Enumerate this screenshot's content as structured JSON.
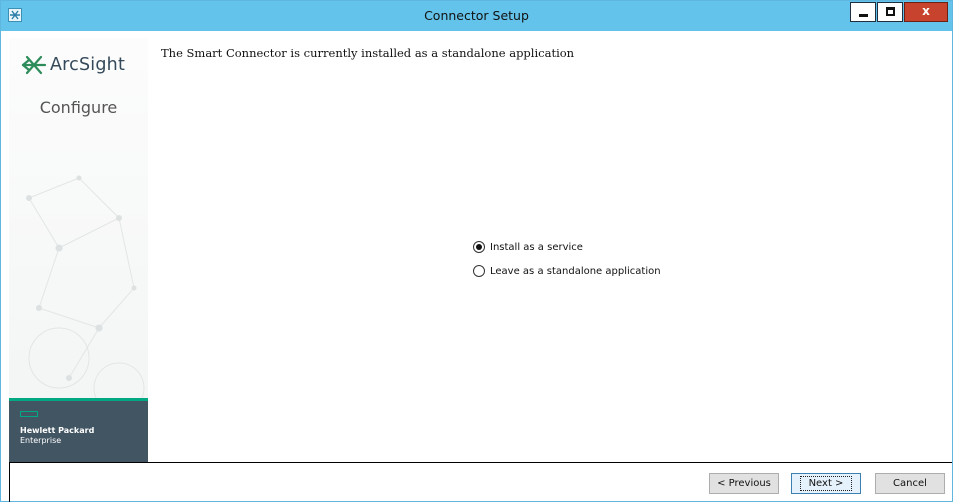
{
  "window": {
    "title": "Connector Setup",
    "close_label": "x"
  },
  "sidebar": {
    "brand": "ArcSight",
    "section": "Configure",
    "company_line1": "Hewlett Packard",
    "company_line2": "Enterprise"
  },
  "main": {
    "message": "The Smart Connector is currently installed as a standalone application",
    "options": [
      {
        "label": "Install as a service",
        "selected": true
      },
      {
        "label": "Leave as a standalone application",
        "selected": false
      }
    ]
  },
  "buttons": {
    "previous": "< Previous",
    "next": "Next >",
    "cancel": "Cancel"
  },
  "colors": {
    "titlebar": "#64c3ea",
    "hpe_green": "#01a982",
    "hpe_band": "#425563"
  }
}
